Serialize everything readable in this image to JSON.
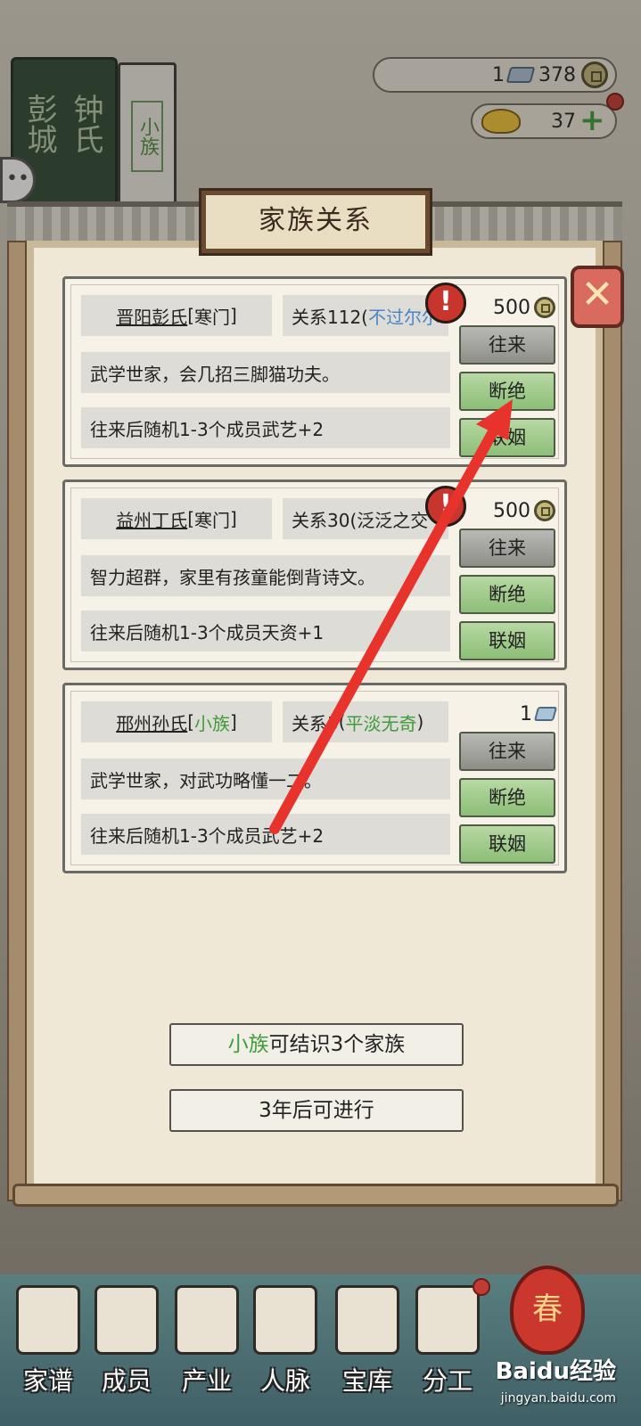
{
  "family_book": {
    "cover_col1": "彭城",
    "cover_col2": "钟氏",
    "tier_tag": "小族",
    "bubble": "••"
  },
  "currency": {
    "silver": "1",
    "copper": "378",
    "gold": "37"
  },
  "dialog": {
    "title": "家族关系",
    "close": "✕"
  },
  "clans": [
    {
      "name": "晋阳彭氏",
      "rank": "寒门",
      "relation_prefix": "关系112(",
      "relation_status": "不过尔尔",
      "description": "武学世家，会几招三脚猫功夫。",
      "effect": "往来后随机1-3个成员武艺+2",
      "cost": "500",
      "cost_type": "copper-coin",
      "alert": "!",
      "actions": [
        "往来",
        "断绝",
        "联姻"
      ]
    },
    {
      "name": "益州丁氏",
      "rank": "寒门",
      "relation_prefix": "关系30(泛泛之交",
      "relation_status": "",
      "description": "智力超群，家里有孩童能倒背诗文。",
      "effect": "往来后随机1-3个成员天资+1",
      "cost": "500",
      "cost_type": "copper-coin",
      "alert": "!",
      "actions": [
        "往来",
        "断绝",
        "联姻"
      ]
    },
    {
      "name": "邢州孙氏",
      "rank": "小族",
      "relation_prefix": "关系5",
      "relation_status": "平淡无奇",
      "description": "武学世家，对武功略懂一二。",
      "effect": "往来后随机1-3个成员武艺+2",
      "cost": "1",
      "cost_type": "silver-ingot",
      "alert": "",
      "actions": [
        "往来",
        "断绝",
        "联姻"
      ]
    }
  ],
  "info": {
    "tier_word": "小族",
    "tier_rest": "可结识3个家族",
    "cooldown": "3年后可进行"
  },
  "nav": [
    "家谱",
    "成员",
    "产业",
    "人脉",
    "宝库",
    "分工"
  ],
  "nav_extra": "春",
  "watermark": {
    "brand": "Baidu经验",
    "url": "jingyan.baidu.com"
  },
  "colors": {
    "status_blue": "#4a86c8",
    "status_green": "#3e9c3a",
    "arrow_red": "#e8332c"
  }
}
